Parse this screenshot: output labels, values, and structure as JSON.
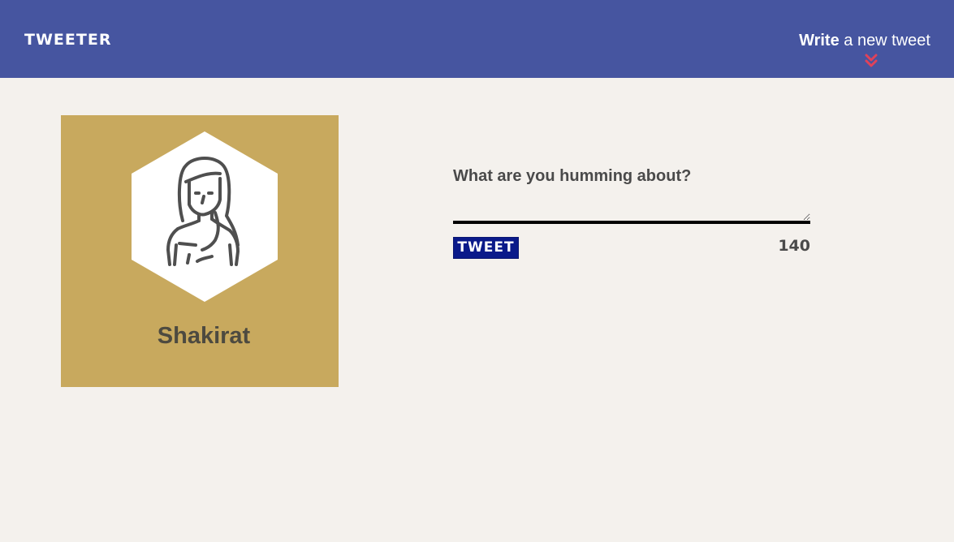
{
  "header": {
    "logo_text": "TWEETER",
    "write_strong": "Write",
    "write_rest": " a new tweet",
    "chevron_icon": "double-chevron-down-icon",
    "background_color": "#4655a0",
    "chevron_color": "#e0425a"
  },
  "profile": {
    "avatar_icon": "user-avatar-icon",
    "name": "Shakirat",
    "card_color": "#c8a95e"
  },
  "composer": {
    "label": "What are you humming about?",
    "textarea_value": "",
    "tweet_button_label": "TWEET",
    "char_counter": "140",
    "button_color": "#0a1a8a"
  }
}
